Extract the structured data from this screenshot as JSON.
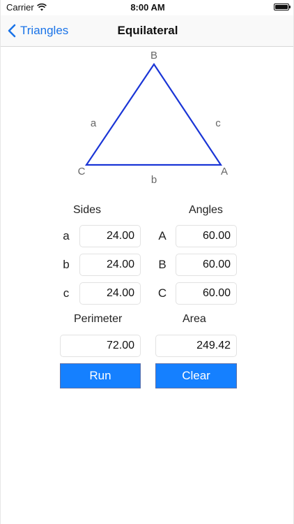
{
  "status": {
    "carrier": "Carrier",
    "time": "8:00 AM"
  },
  "nav": {
    "back_label": "Triangles",
    "title": "Equilateral"
  },
  "triangle": {
    "vertex_a": "A",
    "vertex_b": "B",
    "vertex_c": "C",
    "side_a": "a",
    "side_b": "b",
    "side_c": "c",
    "stroke_color": "#1a35d6"
  },
  "sides": {
    "label": "Sides",
    "rows": [
      {
        "label": "a",
        "value": "24.00"
      },
      {
        "label": "b",
        "value": "24.00"
      },
      {
        "label": "c",
        "value": "24.00"
      }
    ]
  },
  "angles": {
    "label": "Angles",
    "rows": [
      {
        "label": "A",
        "value": "60.00"
      },
      {
        "label": "B",
        "value": "60.00"
      },
      {
        "label": "C",
        "value": "60.00"
      }
    ]
  },
  "perimeter": {
    "label": "Perimeter",
    "value": "72.00"
  },
  "area": {
    "label": "Area",
    "value": "249.42"
  },
  "buttons": {
    "run_label": "Run",
    "clear_label": "Clear"
  },
  "colors": {
    "accent": "#1580ff",
    "link": "#1a73e8"
  }
}
